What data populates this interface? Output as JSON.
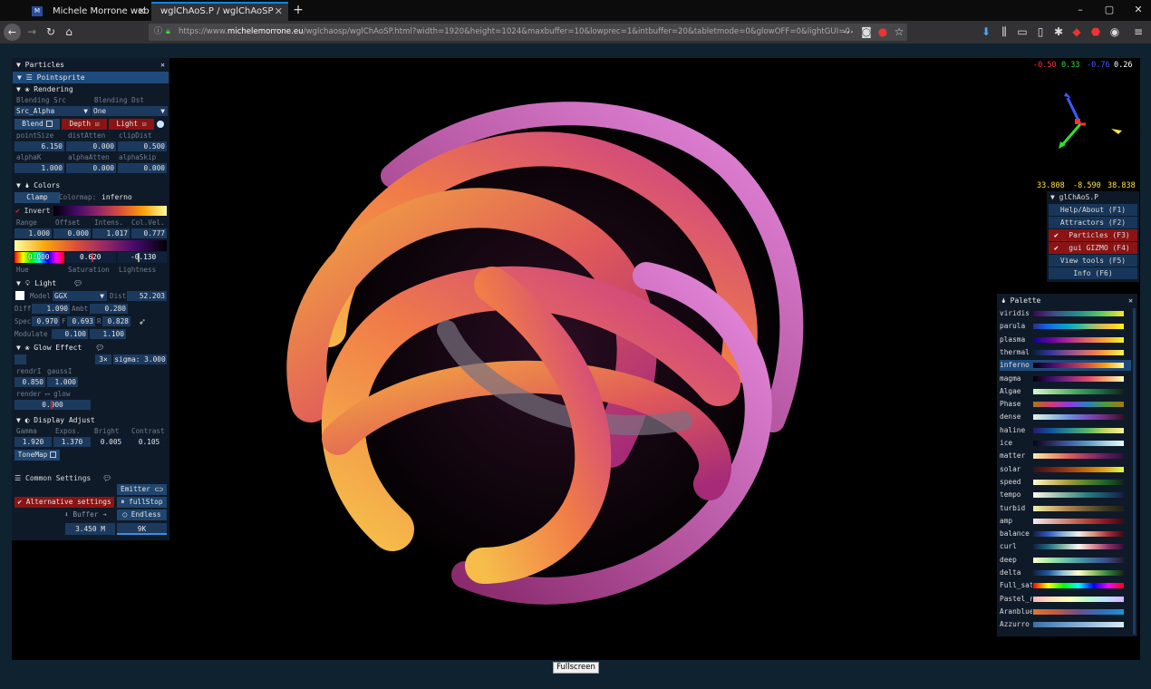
{
  "browser": {
    "tabs": [
      {
        "title": "Michele Morrone web site",
        "active": false
      },
      {
        "title": "wglChAoS.P / wglChAoSP",
        "active": true
      }
    ],
    "new_tab": "+",
    "url_prefix": "https://www.",
    "url_host": "michelemorrone.eu",
    "url_rest": "/wglchaosp/wglChAoSP.html?width=1920&height=1024&maxbuffer=10&lowprec=1&intbuffer=20&tabletmode=0&glowOFF=0&lightGUI=0",
    "window_controls": [
      "–",
      "▢",
      "✕"
    ]
  },
  "particles_panel": {
    "title": "Particles",
    "pointsprite": "Pointsprite",
    "rendering": "Rendering",
    "blending_src_label": "Blending Src",
    "blending_dst_label": "Blending Dst",
    "blending_src": "Src_Alpha",
    "blending_dst": "One",
    "blend": "Blend",
    "depth": "Depth",
    "light": "Light",
    "labels1": [
      "pointSize",
      "distAtten",
      "clipDist"
    ],
    "values1": [
      "6.150",
      "0.000",
      "0.500"
    ],
    "labels2": [
      "alphaK",
      "alphaAtten",
      "alphaSkip"
    ],
    "values2": [
      "1.000",
      "0.000",
      "0.000"
    ],
    "colors": "Colors",
    "clamp": "Clamp",
    "colormap_label": "Colormap:",
    "colormap": "inferno",
    "invert": "Invert",
    "labels3": [
      "Range",
      "Offset",
      "Intens.",
      "Col.Vel."
    ],
    "values3": [
      "1.000",
      "0.000",
      "1.017",
      "0.777"
    ],
    "hsl_values": [
      "0.000",
      "0.620",
      "-0.130"
    ],
    "hsl_labels": [
      "Hue",
      "Saturation",
      "Lightness"
    ],
    "light_section": "Light",
    "model_label": "Model",
    "model": "GGX",
    "dist_label": "Dist",
    "dist": "52.203",
    "diff_label": "Diff",
    "diff": "1.090",
    "ambt_label": "Ambt",
    "ambt": "0.280",
    "spec_label": "Spec",
    "spec": "0.970",
    "f_label": "F",
    "f": "0.693",
    "r_label": "R",
    "r": "0.828",
    "modulate_label": "Modulate",
    "mod1": "0.100",
    "mod2": "1.100",
    "glow": "Glow Effect",
    "glow_x": "3×",
    "sigma": "sigma: 3.000",
    "rendrl_label": "rendrI",
    "gaussl_label": "gaussI",
    "rendrl": "0.850",
    "gaussl": "1.000",
    "render_glow": "render ⟷ glow",
    "render_glow_val": "0.000",
    "display": "Display Adjust",
    "labels4": [
      "Gamma",
      "Expos.",
      "Bright",
      "Contrast"
    ],
    "values4": [
      "1.920",
      "1.370",
      "0.005",
      "0.105"
    ],
    "tonemap": "ToneMap",
    "common": "Common Settings",
    "emitter": "Emitter",
    "alt": "Alternative settings",
    "fullstop": "fullStop",
    "buffer": "Buffer",
    "endless": "Endless",
    "count": "3.450 M",
    "speed": "9K"
  },
  "vector_readout": {
    "x": "-0.50",
    "y": "0.33",
    "z": "-0.76",
    "w": "0.26",
    "colors": [
      "#ff3030",
      "#2fe02f",
      "#3d5bff",
      "#ffffff"
    ]
  },
  "position_readout": [
    "33.808",
    "-8.590",
    "38.838"
  ],
  "main_menu": {
    "title": "glChAoS.P",
    "items": [
      {
        "label": "Help/About (F1)",
        "checked": false
      },
      {
        "label": "Attractors (F2)",
        "checked": false
      },
      {
        "label": "Particles  (F3)",
        "checked": true
      },
      {
        "label": "gui GIZMO  (F4)",
        "checked": true
      },
      {
        "label": "View tools (F5)",
        "checked": false
      },
      {
        "label": "Info       (F6)",
        "checked": false
      }
    ]
  },
  "palette": {
    "title": "Palette",
    "items": [
      {
        "name": "viridis",
        "g": "#440154,#3b528b,#21918c,#5ec962,#fde725"
      },
      {
        "name": "parula",
        "g": "#352a87,#0f5cdd,#1481d6,#06a4ca,#2eb7a4,#87bf77,#d1bb59,#fec832,#f9fb0e"
      },
      {
        "name": "plasma",
        "g": "#0d0887,#6a00a8,#b12a90,#e16462,#fca636,#f0f921"
      },
      {
        "name": "thermal",
        "g": "#042333,#2c3395,#744992,#b15f82,#eb7958,#fbb43d,#e8fa5b"
      },
      {
        "name": "inferno",
        "g": "#000004,#420a68,#932667,#dd513a,#fca50a,#fcffa4"
      },
      {
        "name": "magma",
        "g": "#000004,#3b0f70,#8c2981,#de4968,#fe9f6d,#fcfdbf"
      },
      {
        "name": "Algae",
        "g": "#d7f9d0,#8fce85,#3ea35a,#1a6b3f,#122414"
      },
      {
        "name": "Phase",
        "g": "#a8780d,#d3397a,#8c3be0,#2b7fbe,#4c9a3a,#a8780d"
      },
      {
        "name": "dense",
        "g": "#e6f1f1,#a0c9e0,#6b8fdc,#7b4fbd,#6e2a78,#360e24"
      },
      {
        "name": "haline",
        "g": "#2a186c,#10559a,#2b8a8f,#56b667,#c3d85f,#fdef9a"
      },
      {
        "name": "ice",
        "g": "#040613,#2b2a5d,#3e61a3,#5c9ac0,#a7d2df,#eafdfd"
      },
      {
        "name": "matter",
        "g": "#fdedb0,#f6a56f,#e05c5b,#a63367,#5d1e5c,#2f0f3d"
      },
      {
        "name": "solar",
        "g": "#331418,#6d2116,#9c4012,#c2700e,#e0a81d,#e1fd4b"
      },
      {
        "name": "speed",
        "g": "#fffdcd,#d6c573,#9f9a34,#538327,#1b6529,#172313"
      },
      {
        "name": "tempo",
        "g": "#fff6f4,#b7d0b8,#6ea896,#277b7f,#1b4e68,#151d44"
      },
      {
        "name": "turbid",
        "g": "#e9f6ab,#d1b77a,#a7804c,#6f5b36,#3a3a24,#221e1b"
      },
      {
        "name": "amp",
        "g": "#f1ecec,#e0b1a7,#cc7a64,#b4432e,#8b1527,#3c0912"
      },
      {
        "name": "balance",
        "g": "#181c43,#2a5cbf,#8fb3d6,#f1ecec,#d8957a,#a52b33,#3c0912"
      },
      {
        "name": "curl",
        "g": "#151d44,#1c6d7e,#86b7a6,#fdf5f4,#d98e94,#8b2e68,#340d35"
      },
      {
        "name": "deep",
        "g": "#fdfecc,#a2e3a9,#5fbba9,#40809e,#3d4e8a,#271a2c"
      },
      {
        "name": "delta",
        "g": "#112040,#1c5a9e,#9bc4d4,#fffdcd,#96c46b,#2d7d3b,#172313"
      },
      {
        "name": "Full_sat",
        "g": "#ff0000,#ffff00,#00ff00,#00ffff,#0000ff,#ff00ff,#ff0000"
      },
      {
        "name": "Pastel_r",
        "g": "#ffb3ba,#ffdfba,#ffffba,#baffc9,#bae1ff,#e0b3ff"
      },
      {
        "name": "Aranblue",
        "g": "#d97830,#c05b3f,#6c4f8a,#2f6fb8,#1d92d0"
      },
      {
        "name": "Azzurro",
        "g": "#3b6fa6,#6b98c4,#9fc1df,#d9ecf7"
      }
    ]
  },
  "fullscreen_button": "Fullscreen"
}
